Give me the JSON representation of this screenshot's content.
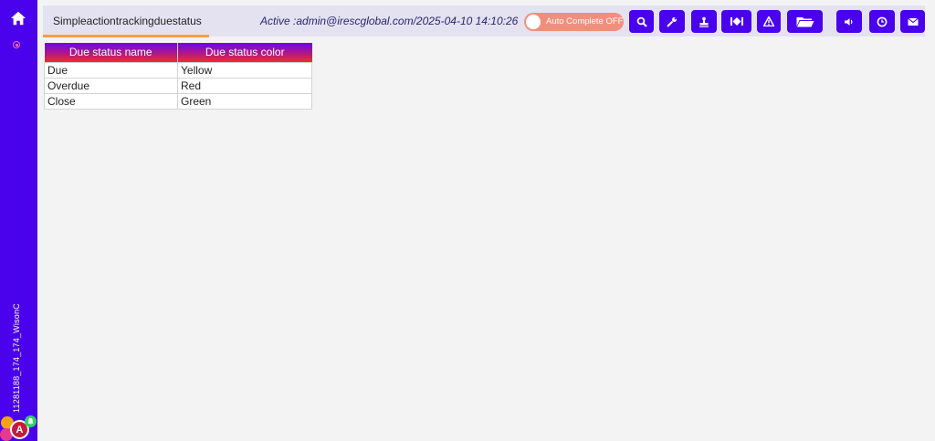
{
  "sidebar": {
    "home_icon": "home-icon",
    "vertical_text": "11281188_174_174_WisonC",
    "avatar_letter": "A"
  },
  "header": {
    "title": "Simpleactiontrackingduestatus",
    "active_text": "Active :admin@irescglobal.com/2025-04-10 14:10:26",
    "toggle_label": "Auto Complete OFF",
    "toolbar_icons": [
      "search-icon",
      "wrench-icon",
      "stamp-icon",
      "skip-icon",
      "warning-icon",
      "folder-icon",
      "speaker-icon",
      "clock-icon",
      "mail-icon"
    ]
  },
  "table": {
    "headers": [
      "Due status name",
      "Due status color"
    ],
    "rows": [
      [
        "Due",
        "Yellow"
      ],
      [
        "Overdue",
        "Red"
      ],
      [
        "Close",
        "Green"
      ]
    ]
  },
  "colors": {
    "sidebar": "#4a02ec",
    "header_bg": "#e4e2f1",
    "toggle": "#f0907c",
    "accent_underline": "#f4a040"
  }
}
